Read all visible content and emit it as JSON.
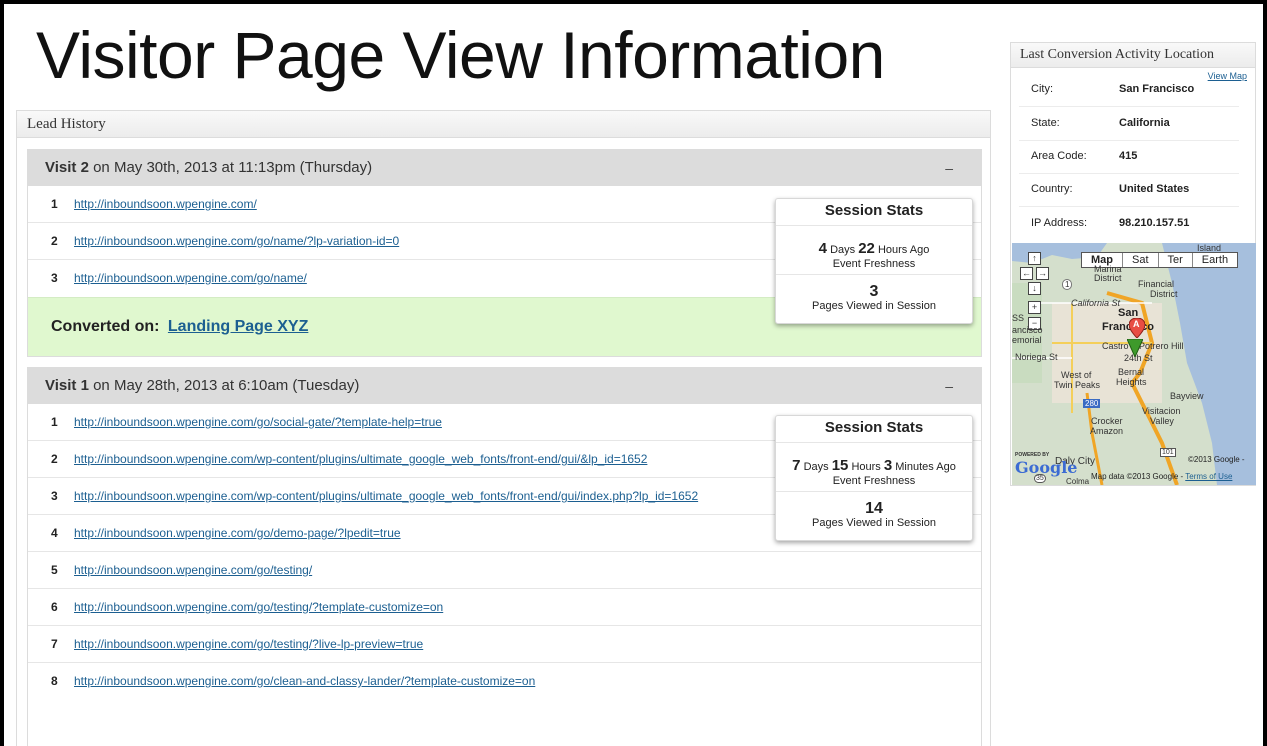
{
  "page": {
    "title": "Visitor Page View Information"
  },
  "lead_history": {
    "header": "Lead History",
    "visits": [
      {
        "name": "Visit 2",
        "date": "on May 30th, 2013 at 11:13pm (Thursday)",
        "collapse": "–",
        "pages": [
          {
            "num": "1",
            "url": "http://inboundsoon.wpengine.com/"
          },
          {
            "num": "2",
            "url": "http://inboundsoon.wpengine.com/go/name/?lp-variation-id=0"
          },
          {
            "num": "3",
            "url": "http://inboundsoon.wpengine.com/go/name/"
          }
        ],
        "converted_label": "Converted on:",
        "converted_link": "Landing Page XYZ",
        "stats": {
          "title": "Session Stats",
          "days": "4",
          "days_label": "Days",
          "hours": "22",
          "hours_label": "Hours",
          "suffix": "Ago",
          "freshness_label": "Event Freshness",
          "pages": "3",
          "pages_label": "Pages Viewed in Session"
        }
      },
      {
        "name": "Visit 1",
        "date": "on May 28th, 2013 at 6:10am (Tuesday)",
        "collapse": "–",
        "pages": [
          {
            "num": "1",
            "url": "http://inboundsoon.wpengine.com/go/social-gate/?template-help=true"
          },
          {
            "num": "2",
            "url": "http://inboundsoon.wpengine.com/wp-content/plugins/ultimate_google_web_fonts/front-end/gui/&lp_id=1652"
          },
          {
            "num": "3",
            "url": "http://inboundsoon.wpengine.com/wp-content/plugins/ultimate_google_web_fonts/front-end/gui/index.php?lp_id=1652"
          },
          {
            "num": "4",
            "url": "http://inboundsoon.wpengine.com/go/demo-page/?lpedit=true"
          },
          {
            "num": "5",
            "url": "http://inboundsoon.wpengine.com/go/testing/"
          },
          {
            "num": "6",
            "url": "http://inboundsoon.wpengine.com/go/testing/?template-customize=on"
          },
          {
            "num": "7",
            "url": "http://inboundsoon.wpengine.com/go/testing/?live-lp-preview=true"
          },
          {
            "num": "8",
            "url": "http://inboundsoon.wpengine.com/go/clean-and-classy-lander/?template-customize=on"
          }
        ],
        "stats": {
          "title": "Session Stats",
          "days": "7",
          "days_label": "Days",
          "hours": "15",
          "hours_label": "Hours",
          "minutes": "3",
          "minutes_label": "Minutes",
          "suffix": "Ago",
          "freshness_label": "Event Freshness",
          "pages": "14",
          "pages_label": "Pages Viewed in Session"
        }
      }
    ]
  },
  "location": {
    "header": "Last Conversion Activity Location",
    "view_map": "View Map",
    "fields": [
      {
        "label": "City:",
        "value": "San Francisco"
      },
      {
        "label": "State:",
        "value": "California"
      },
      {
        "label": "Area Code:",
        "value": "415"
      },
      {
        "label": "Country:",
        "value": "United States"
      },
      {
        "label": "IP Address:",
        "value": "98.210.157.51"
      }
    ]
  },
  "map": {
    "types": [
      "Map",
      "Sat",
      "Ter",
      "Earth"
    ],
    "labels": {
      "island": "Island",
      "marina": "Marina",
      "district": "District",
      "financial": "Financial",
      "financial_district": "District",
      "california_st": "California St",
      "san": "San",
      "francisco": "Francisco",
      "castro": "Castro",
      "potrero_hill": "Potrero Hill",
      "noriega": "Noriega St",
      "twenty_fourth": "24th St",
      "bernal": "Bernal",
      "heights": "Heights",
      "west_of": "West of",
      "twin_peaks": "Twin Peaks",
      "bayview": "Bayview",
      "visitacion": "Visitacion",
      "valley": "Valley",
      "crocker": "Crocker",
      "amazon": "Amazon",
      "daly_city": "Daly City",
      "colma": "Colma",
      "ss": "SS",
      "ancisco": "ancisco",
      "emorial": "emorial",
      "route_1": "1",
      "route_280": "280",
      "route_101": "101",
      "route_35": "35"
    },
    "powered_by": "POWERED BY",
    "google": "Google",
    "copyright": "©2013 Google -",
    "map_data": "Map data ©2013 Google -",
    "terms": "Terms of Use",
    "marker_a": "A"
  }
}
